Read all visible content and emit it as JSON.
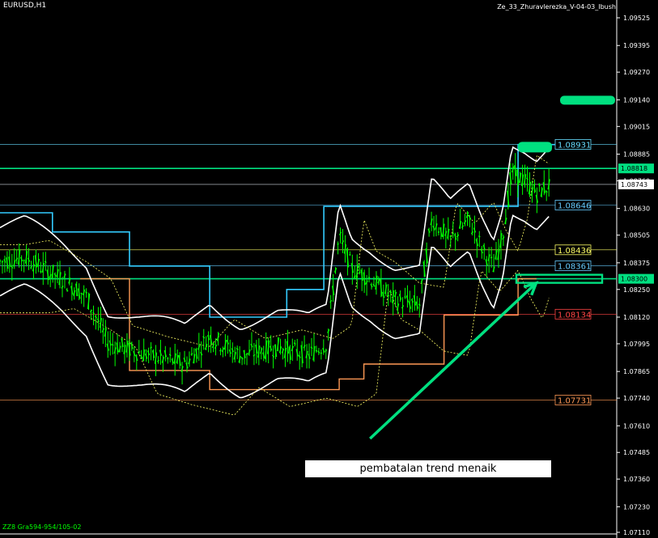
{
  "header": {
    "symbol": "EURUSD,H1",
    "indicator_name": "Ze_33_Zhuravlerezka_V-04-03_Ibush"
  },
  "footer": {
    "label": "ZZ8 Gra594-954/105-02"
  },
  "annotation": {
    "text": "pembatalan trend menaik"
  },
  "colors": {
    "background": "#000000",
    "candles": "#00ff00",
    "bands": "#ffffff",
    "channel": "#33ccff",
    "channel_lower": "#ff9955",
    "accent": "#00e080",
    "level_yellow": "#ffff66",
    "level_red": "#ff4444",
    "level_orange": "#ff9955"
  },
  "chart_data": {
    "type": "candlestick",
    "title": "EURUSD,H1",
    "ylim": [
      1.0711,
      1.0953
    ],
    "y_ticks": [
      "1.09525",
      "1.09395",
      "1.09270",
      "1.09140",
      "1.09015",
      "1.08885",
      "1.08760",
      "1.08630",
      "1.08505",
      "1.08375",
      "1.08250",
      "1.08120",
      "1.07995",
      "1.07865",
      "1.07740",
      "1.07610",
      "1.07485",
      "1.07360",
      "1.07230",
      "1.07110"
    ],
    "price_levels": [
      {
        "label": "1.08931",
        "value": 1.08931,
        "color": "#66ddff"
      },
      {
        "label": "1.08818",
        "value": 1.08818,
        "color": "#00e080",
        "filled": true
      },
      {
        "label": "1.08743",
        "value": 1.08743,
        "color": "#cfd8e0",
        "filled": true,
        "current": true
      },
      {
        "label": "1.08646",
        "value": 1.08646,
        "color": "#66ccff"
      },
      {
        "label": "1.08436",
        "value": 1.08436,
        "color": "#ffff66"
      },
      {
        "label": "1.08361",
        "value": 1.08361,
        "color": "#66ccff"
      },
      {
        "label": "1.08300",
        "value": 1.083,
        "color": "#00e080",
        "filled": true
      },
      {
        "label": "1.08134",
        "value": 1.08134,
        "color": "#ff4444"
      },
      {
        "label": "1.07731",
        "value": 1.07731,
        "color": "#ff9955"
      }
    ],
    "target_markers": [
      1.0914,
      1.0892
    ],
    "arrow": {
      "from": [
        0.6,
        1.0755
      ],
      "to": [
        0.83,
        1.0828
      ]
    },
    "grid": false,
    "legend": "none"
  }
}
